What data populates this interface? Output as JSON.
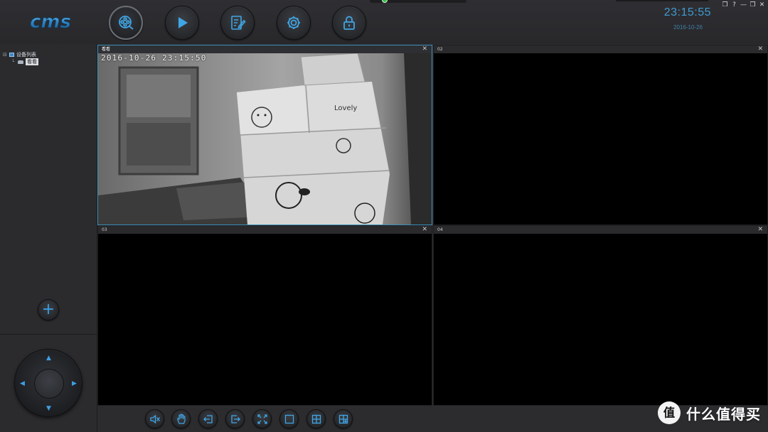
{
  "app": {
    "logo_text": "cms"
  },
  "header": {
    "clock": "23:15:55",
    "date": "2016-10-26",
    "nav": [
      {
        "id": "live",
        "icon": "film-reel-icon",
        "active": true
      },
      {
        "id": "playback",
        "icon": "play-icon",
        "active": false
      },
      {
        "id": "log",
        "icon": "edit-note-icon",
        "active": false
      },
      {
        "id": "settings",
        "icon": "gear-icon",
        "active": false
      },
      {
        "id": "lock",
        "icon": "lock-icon",
        "active": false
      }
    ],
    "window_controls": [
      "❐",
      "?",
      "—",
      "❐",
      "✕"
    ]
  },
  "sidebar": {
    "tree": {
      "root_toggle": "⊟",
      "root_label": "设备列表",
      "child_toggle": "└",
      "child_label": "看看"
    },
    "add_button": "+",
    "ptz": {
      "up": "▲",
      "down": "▼",
      "left": "◀",
      "right": "▶"
    }
  },
  "panes": [
    {
      "title": "看看",
      "close": "✕",
      "osd": "2016-10-26  23:15:50",
      "selected": true,
      "has_video": true
    },
    {
      "title": "02",
      "close": "✕",
      "selected": false,
      "has_video": false
    },
    {
      "title": "03",
      "close": "✕",
      "selected": false,
      "has_video": false
    },
    {
      "title": "04",
      "close": "✕",
      "selected": false,
      "has_video": false
    }
  ],
  "toolbar": {
    "buttons": [
      {
        "icon": "mute-speaker-icon"
      },
      {
        "icon": "hand-icon"
      },
      {
        "icon": "export-left-icon"
      },
      {
        "icon": "export-right-icon"
      },
      {
        "icon": "fullscreen-icon"
      },
      {
        "icon": "layout-1-icon"
      },
      {
        "icon": "layout-4-icon"
      },
      {
        "icon": "layout-custom-icon"
      }
    ]
  },
  "watermark": {
    "text": "什么值得买"
  },
  "colors": {
    "accent": "#3f9bd1",
    "selected_border": "#3c8fb8",
    "status_green": "#2fc43d"
  }
}
